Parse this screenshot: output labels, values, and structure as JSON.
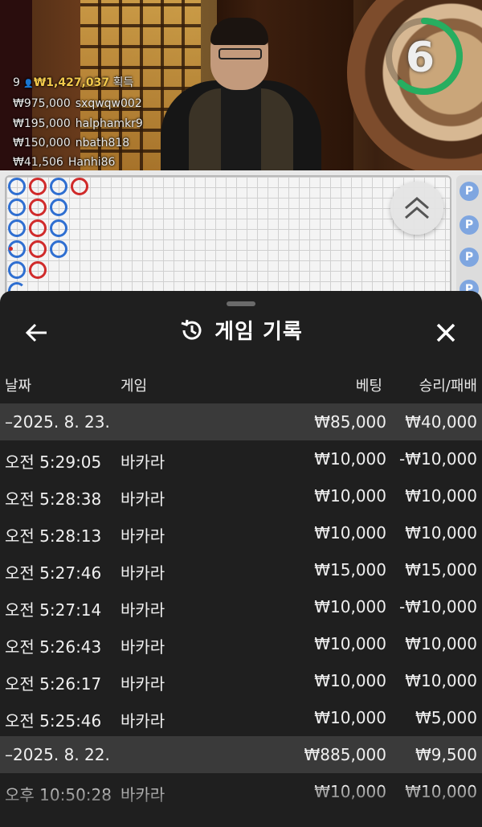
{
  "stream": {
    "round_count": "9",
    "total_won": "₩1,427,037",
    "won_suffix": "획득",
    "winners": [
      {
        "amount": "₩975,000",
        "name": "sxqwqw002"
      },
      {
        "amount": "₩195,000",
        "name": "halphamkr9"
      },
      {
        "amount": "₩150,000",
        "name": "nbath818"
      },
      {
        "amount": "₩41,506",
        "name": "Hanhi86"
      }
    ],
    "countdown": "6",
    "countdown_color": "#27ae60"
  },
  "road": {
    "player_color": "#2f6fd1",
    "banker_color": "#d02b2b",
    "side_label": "P"
  },
  "history": {
    "title": "게임 기록",
    "icons": {
      "back": "arrow-left-icon",
      "title": "history-icon",
      "close": "close-icon"
    },
    "columns": {
      "date": "날짜",
      "game": "게임",
      "bet": "베팅",
      "result": "승리/패배"
    },
    "rows": [
      {
        "type": "group",
        "date": "–2025. 8. 23.",
        "bet": "₩85,000",
        "result": "₩40,000"
      },
      {
        "type": "item",
        "date": "오전 5:29:05",
        "game": "바카라",
        "bet": "₩10,000",
        "result": "-₩10,000"
      },
      {
        "type": "item",
        "date": "오전 5:28:38",
        "game": "바카라",
        "bet": "₩10,000",
        "result": "₩10,000"
      },
      {
        "type": "item",
        "date": "오전 5:28:13",
        "game": "바카라",
        "bet": "₩10,000",
        "result": "₩10,000"
      },
      {
        "type": "item",
        "date": "오전 5:27:46",
        "game": "바카라",
        "bet": "₩15,000",
        "result": "₩15,000"
      },
      {
        "type": "item",
        "date": "오전 5:27:14",
        "game": "바카라",
        "bet": "₩10,000",
        "result": "-₩10,000"
      },
      {
        "type": "item",
        "date": "오전 5:26:43",
        "game": "바카라",
        "bet": "₩10,000",
        "result": "₩10,000"
      },
      {
        "type": "item",
        "date": "오전 5:26:17",
        "game": "바카라",
        "bet": "₩10,000",
        "result": "₩10,000"
      },
      {
        "type": "item",
        "date": "오전 5:25:46",
        "game": "바카라",
        "bet": "₩10,000",
        "result": "₩5,000"
      },
      {
        "type": "group",
        "date": "–2025. 8. 22.",
        "bet": "₩885,000",
        "result": "₩9,500"
      },
      {
        "type": "item",
        "date": "오후 10:50:28",
        "game": "바카라",
        "bet": "₩10,000",
        "result": "₩10,000"
      }
    ]
  }
}
